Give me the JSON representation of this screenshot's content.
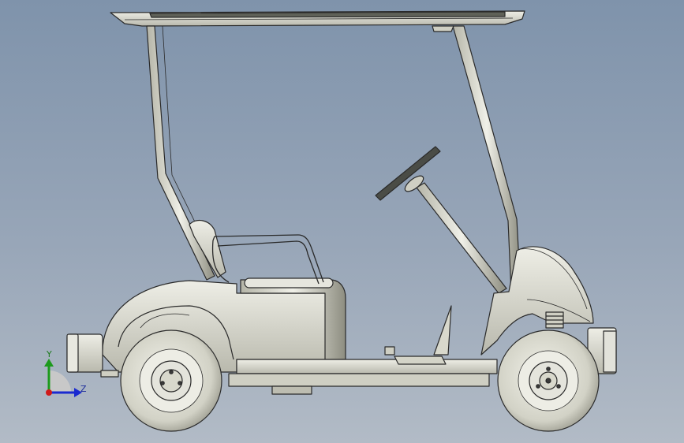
{
  "viewport": {
    "background_top": "#7f93ab",
    "background_bottom": "#b2bbc6"
  },
  "model": {
    "name_icon": "golf-cart-model",
    "fill": "#d8d8cc",
    "stroke": "#2a2a2a"
  },
  "triad": {
    "y_label": "Y",
    "z_label": "Z",
    "y_color": "#1c9a1c",
    "z_color": "#1a2ad0",
    "x_color": "#d01a1a"
  }
}
